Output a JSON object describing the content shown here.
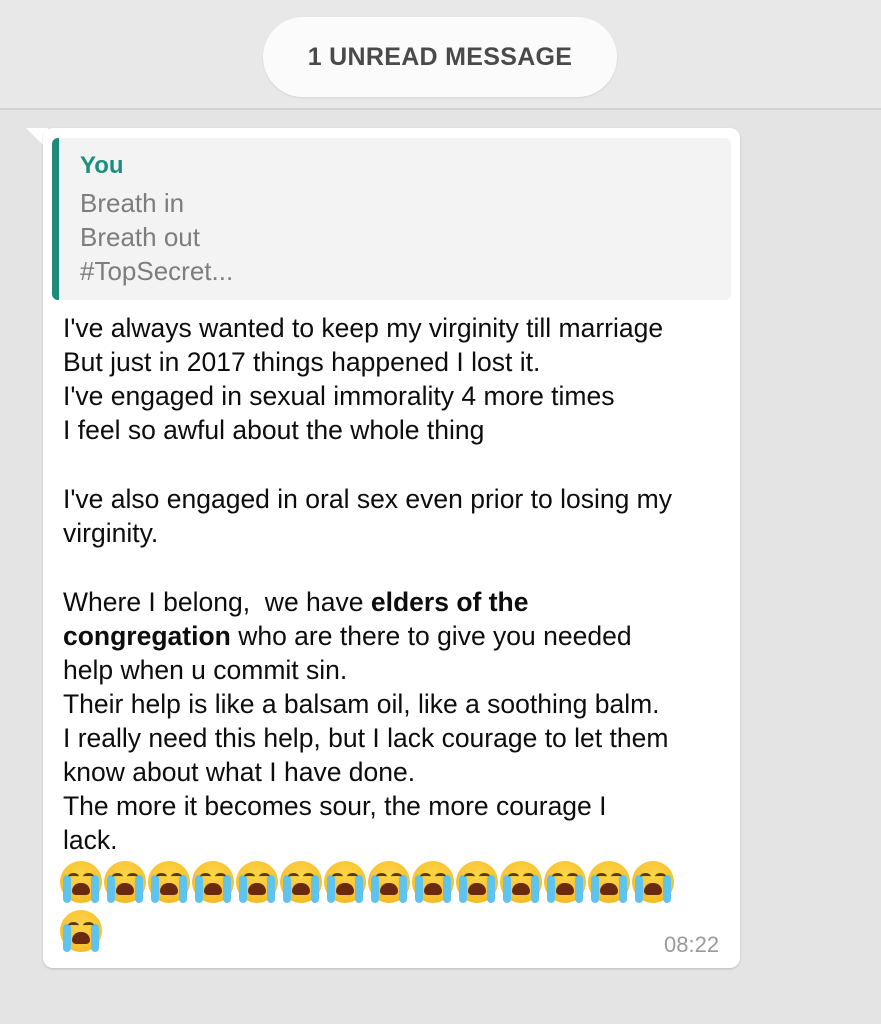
{
  "banner": {
    "label": "1 UNREAD MESSAGE"
  },
  "quote": {
    "author": "You",
    "lines": [
      "Breath in",
      "Breath out",
      "#TopSecret..."
    ]
  },
  "message": {
    "lines": [
      "I've always wanted to keep my virginity till marriage",
      "But just in 2017 things happened I lost it.",
      "I've engaged in sexual immorality 4 more times",
      "I feel so awful about the whole thing",
      "I've also engaged in oral sex even prior to losing my",
      "virginity.",
      "Where I belong,  we have ",
      "elders of the",
      "congregation",
      " who are there to give you needed",
      "help when u commit sin.",
      "Their help is like a balsam oil,  like a soothing balm.",
      "I really need this help, but I lack courage to let them",
      "know about what I have done.",
      "The more it becomes sour,  the more courage I",
      "lack."
    ],
    "emoji_name": "loudly-crying-face-icon",
    "emoji_count": 15,
    "time": "08:22"
  },
  "colors": {
    "accent": "#1d8a7a",
    "author": "#1a8f7e",
    "background": "#e4e4e4",
    "bubble": "#ffffff"
  }
}
